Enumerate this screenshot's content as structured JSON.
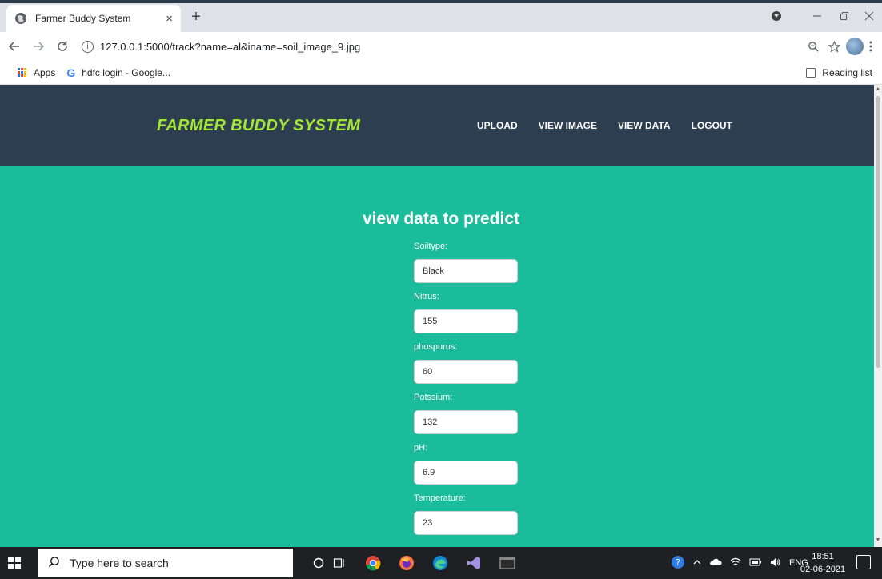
{
  "browser": {
    "tab_title": "Farmer Buddy System",
    "tab_close": "×",
    "new_tab": "+",
    "url": "127.0.0.1:5000/track?name=al&iname=soil_image_9.jpg",
    "bookmarks": [
      {
        "label": "Apps"
      },
      {
        "label": "hdfc login - Google..."
      }
    ],
    "reading_list": "Reading list"
  },
  "site": {
    "brand": "FARMER BUDDY SYSTEM",
    "nav": [
      "UPLOAD",
      "VIEW IMAGE",
      "VIEW DATA",
      "LOGOUT"
    ]
  },
  "form": {
    "title": "view data to predict",
    "fields": [
      {
        "label": "Soiltype:",
        "value": "Black"
      },
      {
        "label": "Nitrus:",
        "value": "155"
      },
      {
        "label": "phospurus:",
        "value": "60"
      },
      {
        "label": "Potssium:",
        "value": "132"
      },
      {
        "label": "pH:",
        "value": "6.9"
      },
      {
        "label": "Temperature:",
        "value": "23"
      }
    ]
  },
  "taskbar": {
    "search_placeholder": "Type here to search",
    "language": "ENG",
    "time": "18:51",
    "date": "02-06-2021"
  },
  "colors": {
    "header_bg": "#2c3e50",
    "content_bg": "#1abc9c",
    "brand": "#a3e635"
  }
}
